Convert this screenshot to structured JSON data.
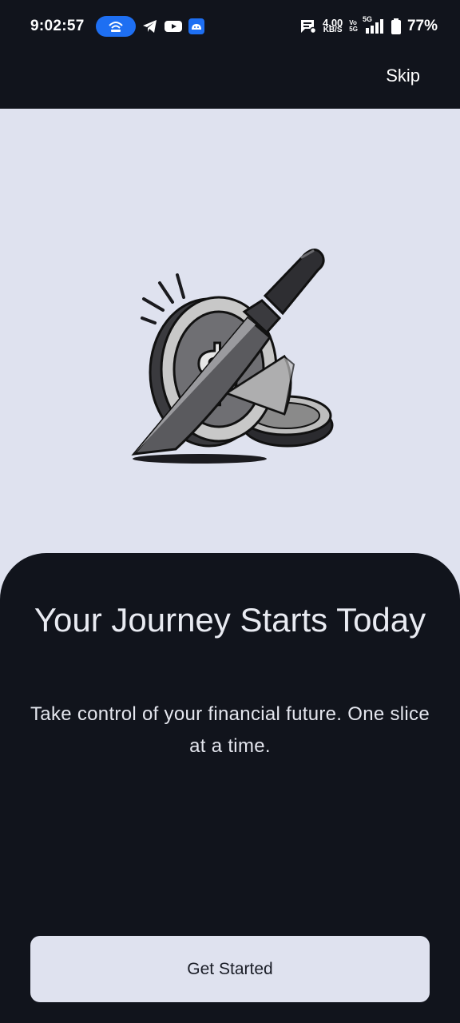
{
  "status_bar": {
    "time": "9:02:57",
    "net_speed_value": "4.00",
    "net_speed_unit": "KB/S",
    "volte_top": "Vo",
    "volte_bottom": "5G",
    "network": "5G",
    "battery": "77%"
  },
  "header": {
    "skip_label": "Skip"
  },
  "onboarding": {
    "title": "Your Journey Starts Today",
    "subtitle": "Take control of your financial future. One slice at a time.",
    "illustration_icon": "knife-slicing-coin-icon"
  },
  "actions": {
    "get_started_label": "Get Started"
  },
  "colors": {
    "dark_bg": "#11141c",
    "hero_bg": "#dfe2ef",
    "accent_blue": "#1e6ff2",
    "button_bg": "#dfe2ef"
  }
}
